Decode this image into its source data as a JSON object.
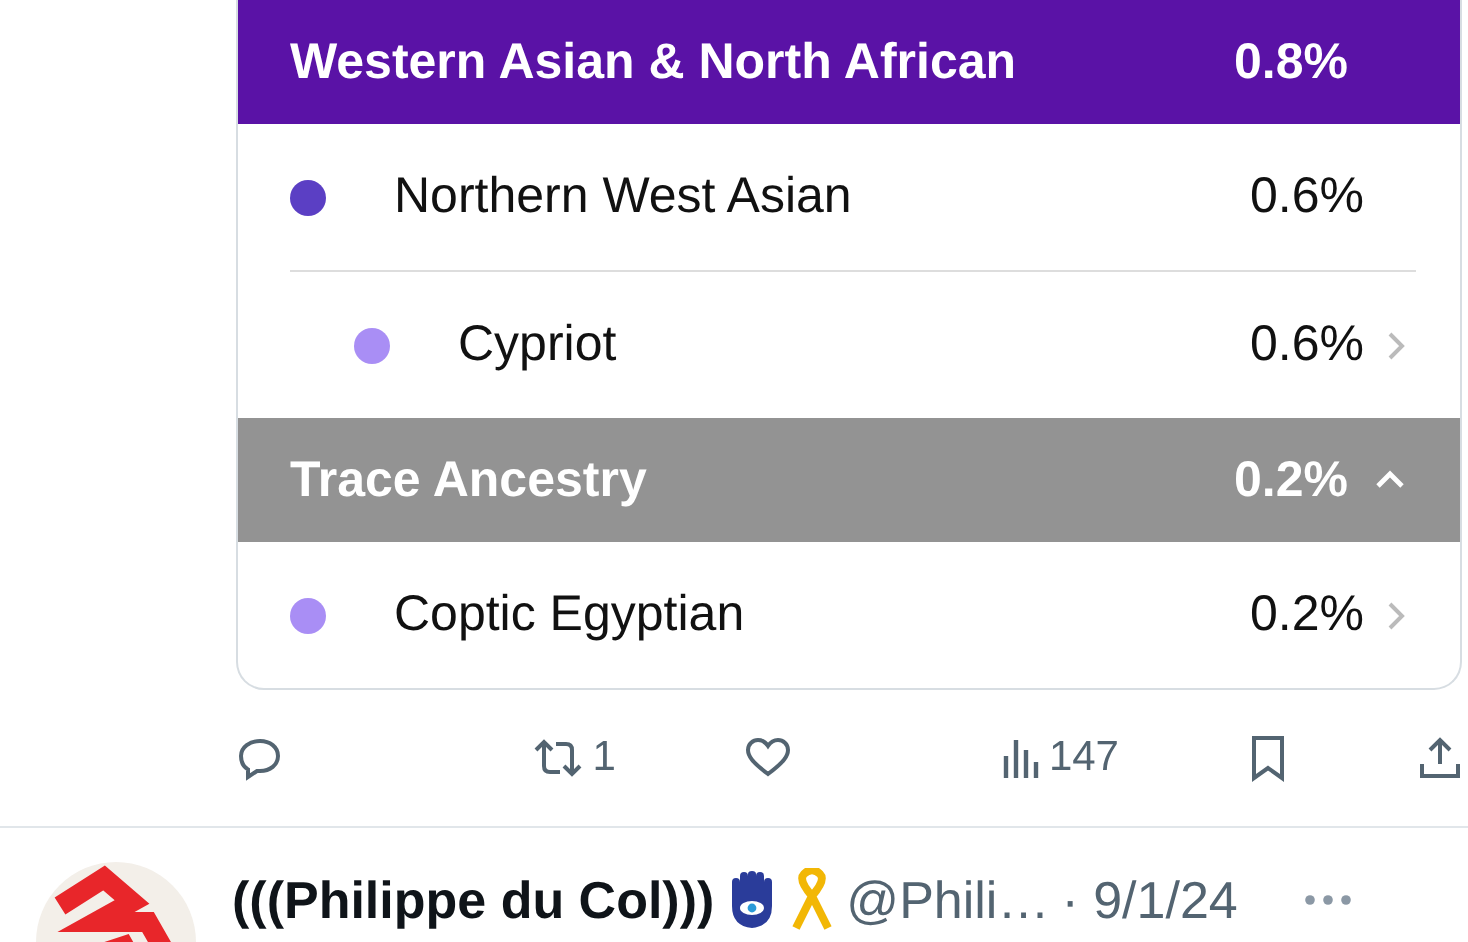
{
  "ancestry_card": {
    "groups": [
      {
        "label": "Western Asian & North African",
        "percent": "0.8%",
        "color": "#5a12a6",
        "items": [
          {
            "name": "Northern West Asian",
            "percent": "0.6%",
            "color": "#5b3fc4",
            "children": [
              {
                "name": "Cypriot",
                "percent": "0.6%",
                "color": "#a98ef5",
                "link": true
              }
            ]
          }
        ]
      },
      {
        "label": "Trace Ancestry",
        "percent": "0.2%",
        "color": "#939393",
        "expanded": true,
        "items": [
          {
            "name": "Coptic Egyptian",
            "percent": "0.2%",
            "color": "#a98ef5",
            "link": true
          }
        ]
      }
    ]
  },
  "actions": [
    {
      "kind": "reply"
    },
    {
      "kind": "repost",
      "count": "1"
    },
    {
      "kind": "like"
    },
    {
      "kind": "views",
      "count": "147"
    },
    {
      "kind": "bookmark"
    },
    {
      "kind": "share"
    }
  ],
  "next_post": {
    "name": "(((Philippe du Col)))",
    "handle": "@Phili…",
    "date": "· 9/1/24"
  }
}
